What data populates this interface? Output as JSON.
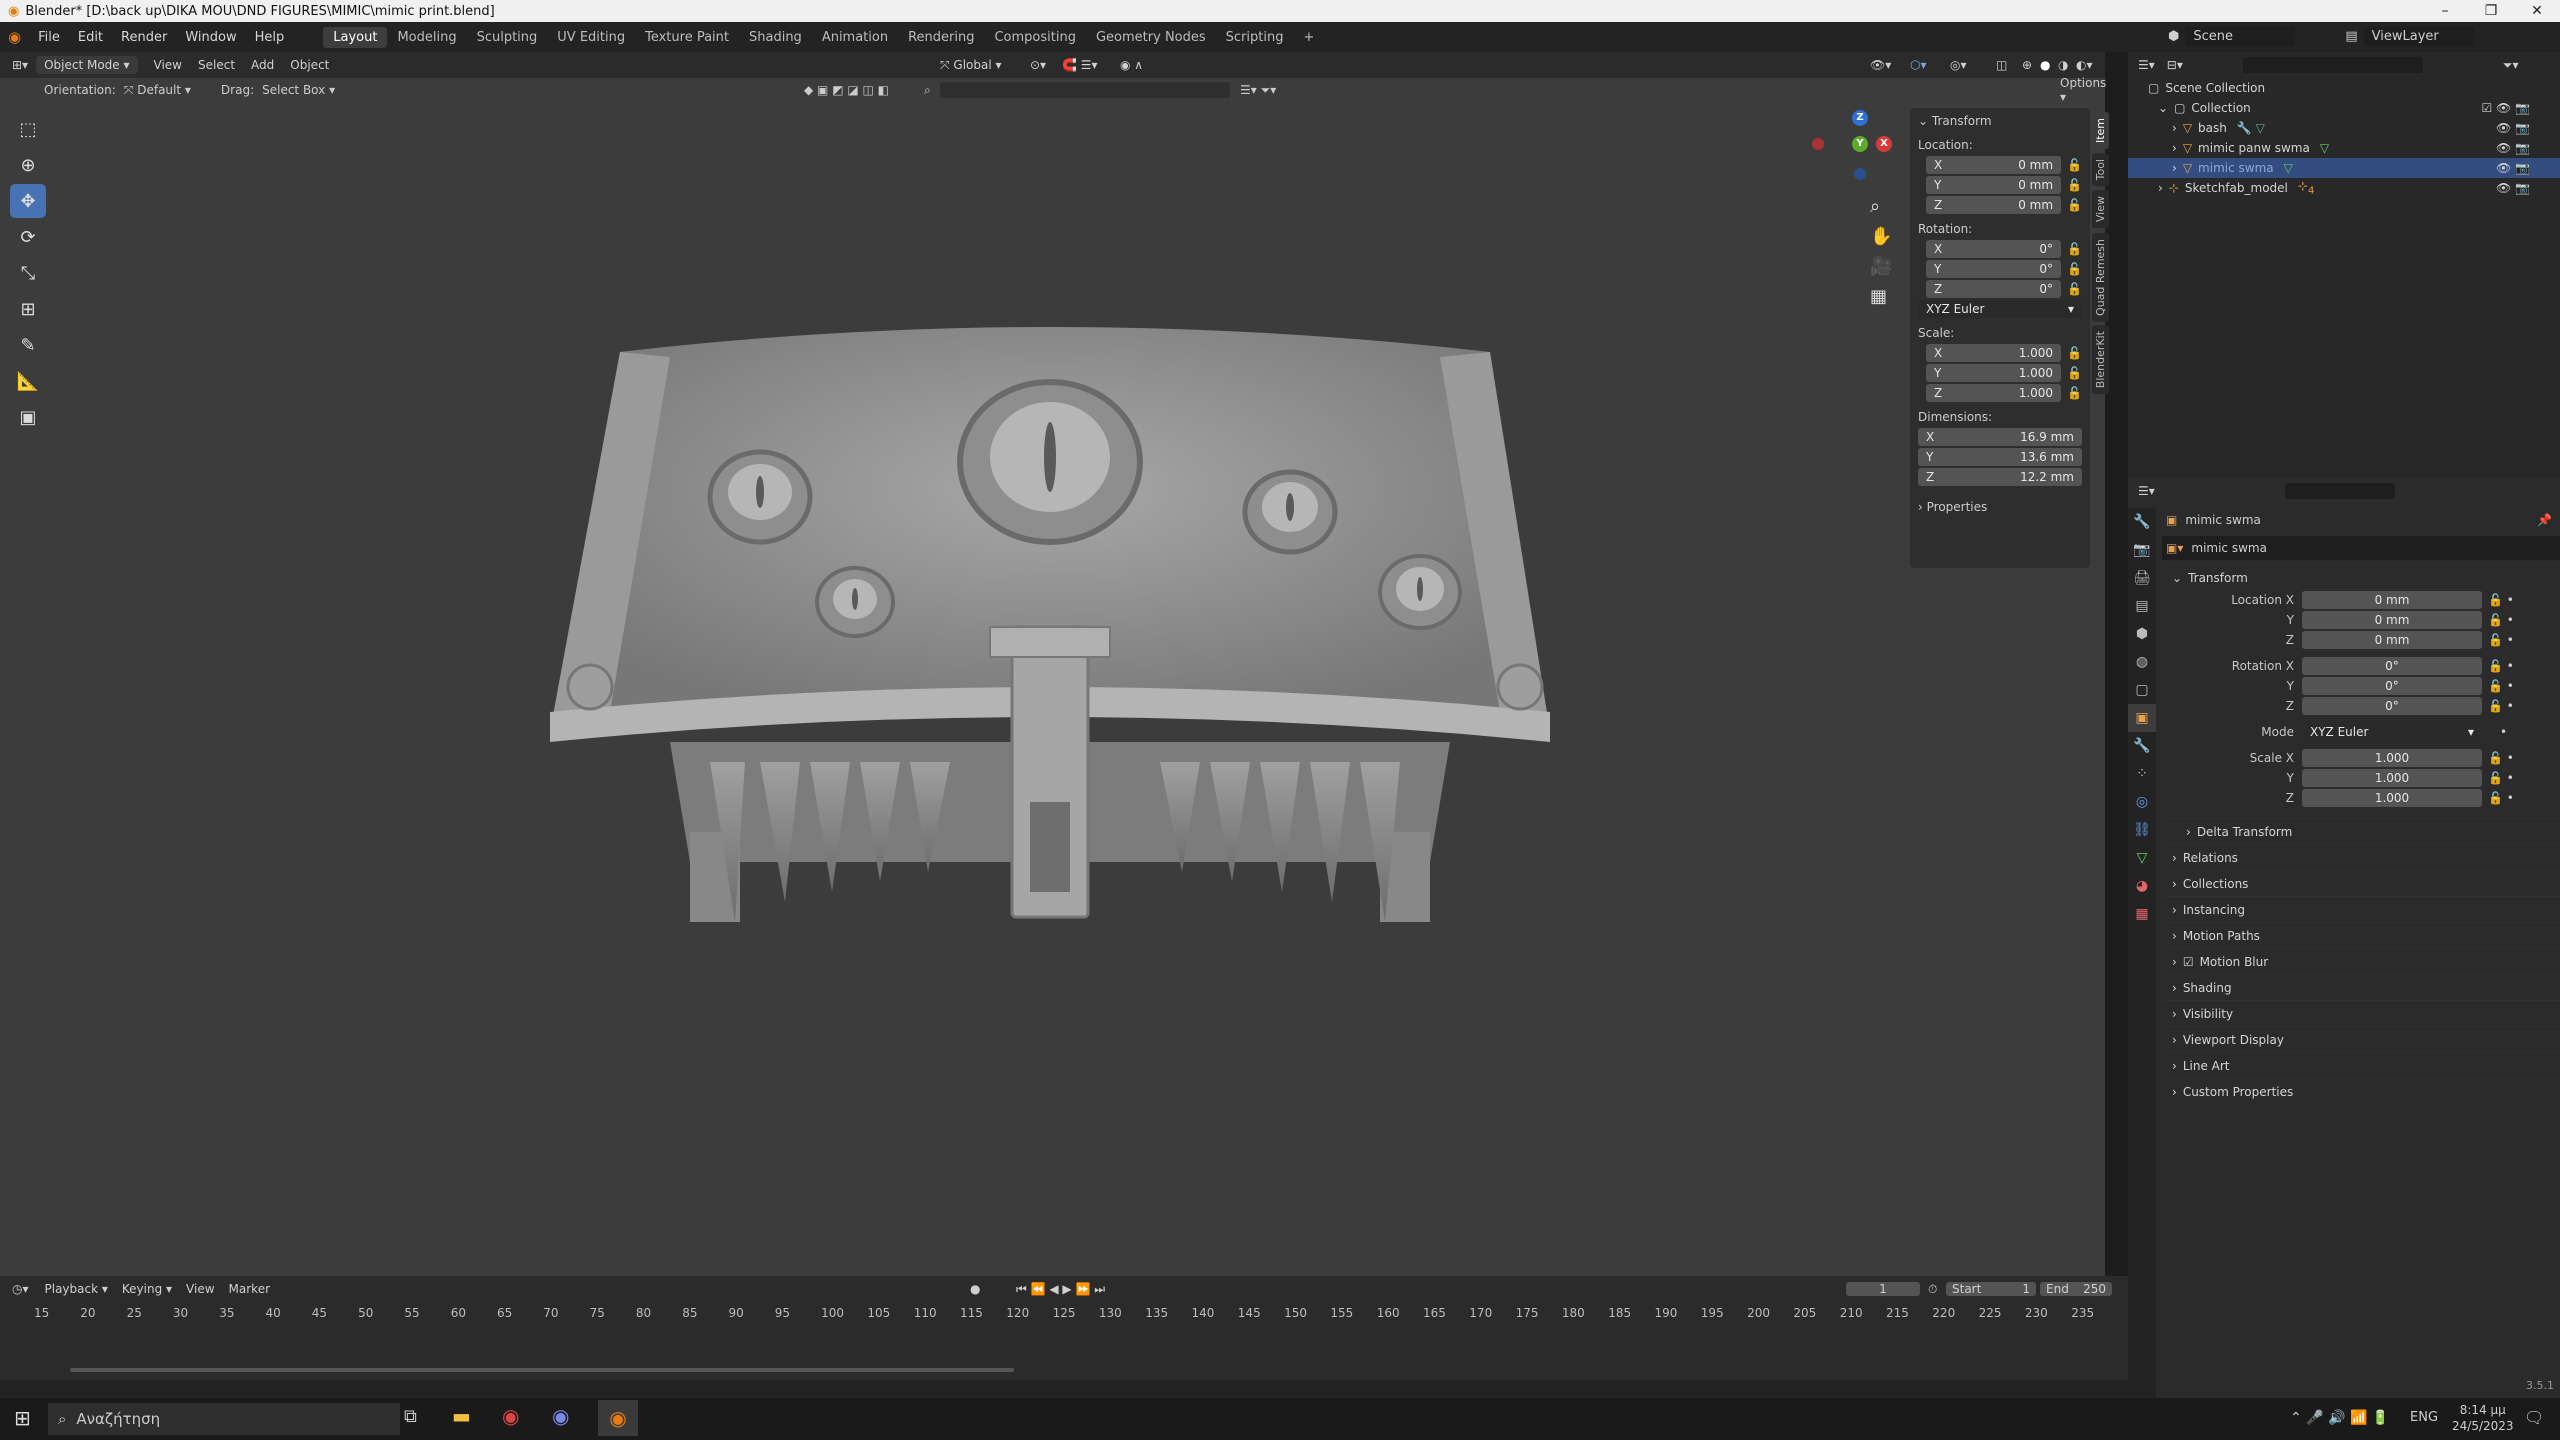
{
  "window": {
    "title": "Blender* [D:\\back up\\DIKA MOU\\DND FIGURES\\MIMIC\\mimic print.blend]"
  },
  "menu": {
    "items": [
      "File",
      "Edit",
      "Render",
      "Window",
      "Help"
    ]
  },
  "workspaces": {
    "tabs": [
      "Layout",
      "Modeling",
      "Sculpting",
      "UV Editing",
      "Texture Paint",
      "Shading",
      "Animation",
      "Rendering",
      "Compositing",
      "Geometry Nodes",
      "Scripting"
    ],
    "active": "Layout"
  },
  "scene": {
    "name": "Scene",
    "view_layer": "ViewLayer"
  },
  "viewport": {
    "mode": "Object Mode",
    "menu": [
      "View",
      "Select",
      "Add",
      "Object"
    ],
    "transform_orientation": "Global",
    "orientation_label": "Orientation:",
    "orientation_value": "Default",
    "drag_label": "Drag:",
    "drag_value": "Select Box",
    "options": "Options"
  },
  "npanel": {
    "section": "Transform",
    "location_label": "Location:",
    "location": {
      "x": "0 mm",
      "y": "0 mm",
      "z": "0 mm"
    },
    "rotation_label": "Rotation:",
    "rotation": {
      "x": "0°",
      "y": "0°",
      "z": "0°"
    },
    "rotation_mode": "XYZ Euler",
    "scale_label": "Scale:",
    "scale": {
      "x": "1.000",
      "y": "1.000",
      "z": "1.000"
    },
    "dimensions_label": "Dimensions:",
    "dimensions": {
      "x": "16.9 mm",
      "y": "13.6 mm",
      "z": "12.2 mm"
    },
    "properties": "Properties",
    "tabs": [
      "Item",
      "Tool",
      "View",
      "Quad Remesh",
      "BlenderKit"
    ],
    "axis": {
      "x": "X",
      "y": "Y",
      "z": "Z"
    }
  },
  "outliner": {
    "root": "Scene Collection",
    "collection": "Collection",
    "items": [
      "bash",
      "mimic panw swma",
      "mimic swma"
    ],
    "other": "Sketchfab_model",
    "other_badge": "4"
  },
  "properties": {
    "object_name": "mimic swma",
    "data_name": "mimic swma",
    "transform": "Transform",
    "location_x_label": "Location X",
    "rotation_x_label": "Rotation X",
    "scale_x_label": "Scale X",
    "y_label": "Y",
    "z_label": "Z",
    "mode_label": "Mode",
    "mode_value": "XYZ Euler",
    "location": [
      "0 mm",
      "0 mm",
      "0 mm"
    ],
    "rotation": [
      "0°",
      "0°",
      "0°"
    ],
    "scale": [
      "1.000",
      "1.000",
      "1.000"
    ],
    "delta": "Delta Transform",
    "sections": [
      "Relations",
      "Collections",
      "Instancing",
      "Motion Paths",
      "Motion Blur",
      "Shading",
      "Visibility",
      "Viewport Display",
      "Line Art",
      "Custom Properties"
    ]
  },
  "timeline": {
    "menu": [
      "Playback",
      "Keying",
      "View",
      "Marker"
    ],
    "current_frame": "1",
    "start_label": "Start",
    "start": "1",
    "end_label": "End",
    "end": "250",
    "ticks": [
      "15",
      "20",
      "25",
      "30",
      "35",
      "40",
      "45",
      "50",
      "55",
      "60",
      "65",
      "70",
      "75",
      "80",
      "85",
      "90",
      "95",
      "100",
      "105",
      "110",
      "115",
      "120",
      "125",
      "130",
      "135",
      "140",
      "145",
      "150",
      "155",
      "160",
      "165",
      "170",
      "175",
      "180",
      "185",
      "190",
      "195",
      "200",
      "205",
      "210",
      "215",
      "220",
      "225",
      "230",
      "235"
    ]
  },
  "statusbar": {
    "version": "3.5.1"
  },
  "taskbar": {
    "search_placeholder": "Αναζήτηση",
    "lang": "ENG",
    "time": "8:14 μμ",
    "date": "24/5/2023"
  },
  "colors": {
    "accent": "#4772b3",
    "viewport_bg": "#3c3c3c",
    "selection": "#334d80"
  }
}
